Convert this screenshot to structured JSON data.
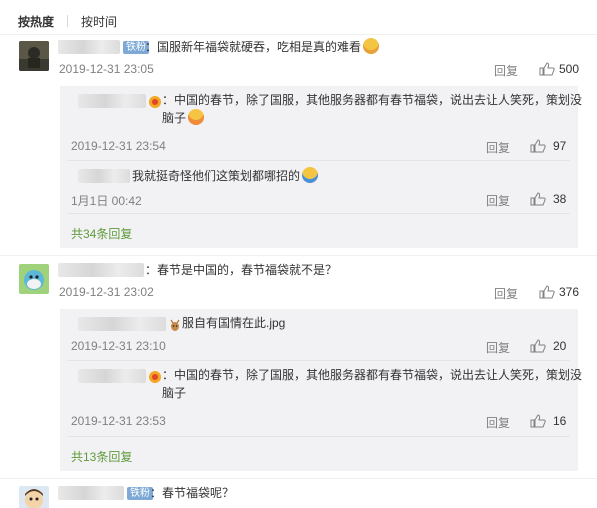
{
  "sort": {
    "hot": "按热度",
    "time": "按时间"
  },
  "comments": [
    {
      "badge": "铁粉",
      "text": "：国服新年福袋就硬吞，吃相是真的难看",
      "time": "2019-12-31 23:05",
      "reply_label": "回复",
      "likes": "500",
      "replies": [
        {
          "text": "：中国的春节，除了国服，其他服务器都有春节福袋，说出去让人笑死，策划没脑子",
          "time": "2019-12-31 23:54",
          "reply_label": "回复",
          "likes": "97"
        },
        {
          "text": "我就挺奇怪他们这策划都哪招的",
          "time": "1月1日 00:42",
          "reply_label": "回复",
          "likes": "38"
        }
      ],
      "more": "共34条回复"
    },
    {
      "text": "：春节是中国的，春节福袋就不是？",
      "time": "2019-12-31 23:02",
      "reply_label": "回复",
      "likes": "376",
      "replies": [
        {
          "text": "服自有国情在此.jpg",
          "time": "2019-12-31 23:10",
          "reply_label": "回复",
          "likes": "20"
        },
        {
          "text": "：中国的春节，除了国服，其他服务器都有春节福袋，说出去让人笑死，策划没脑子",
          "time": "2019-12-31 23:53",
          "reply_label": "回复",
          "likes": "16"
        }
      ],
      "more": "共13条回复"
    },
    {
      "badge": "铁粉",
      "text": "：春节福袋呢？"
    }
  ],
  "colors": {
    "accent_green": "#5f9b3a",
    "badge_blue": "#7ea9d6",
    "reply_bg": "#f2f2f5",
    "meta_gray": "#808080"
  }
}
